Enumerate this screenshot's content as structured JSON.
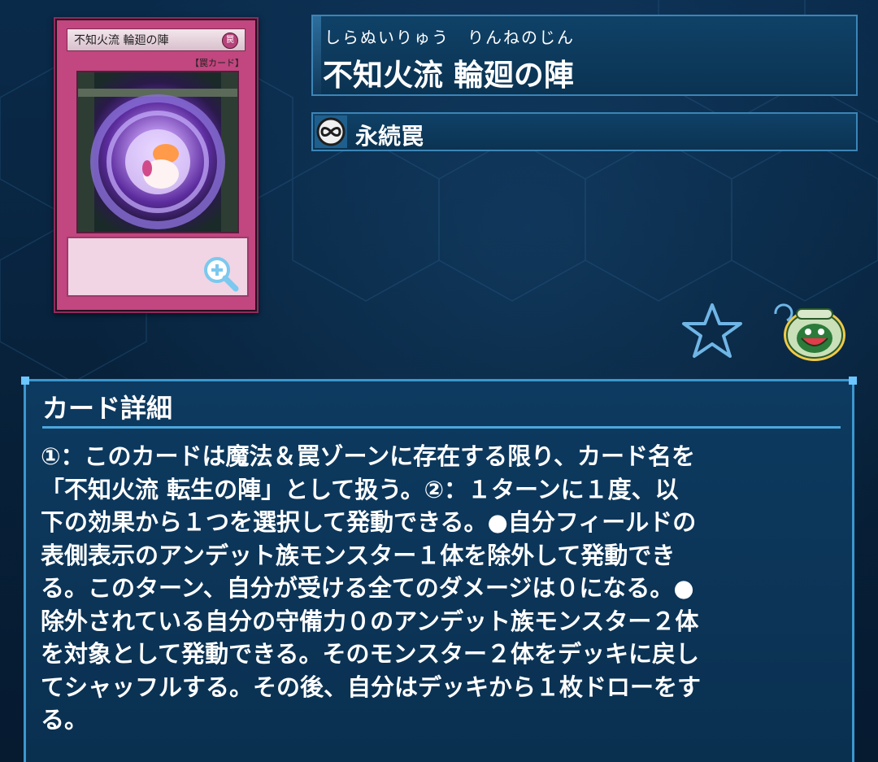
{
  "card": {
    "image_name_text": "不知火流 輪廻の陣",
    "image_type_text": "【罠カード】",
    "furigana": "しらぬいりゅう　りんねのじん",
    "name": "不知火流 輪廻の陣",
    "type_label": "永続罠",
    "type_icon": "continuous-icon"
  },
  "actions": {
    "zoom_icon": "zoom-in-icon",
    "favorite_icon": "star-icon",
    "pot_icon": "pot-of-greed-icon"
  },
  "details": {
    "title": "カード詳細",
    "text": "①：このカードは魔法＆罠ゾーンに存在する限り、カード名を\n「不知火流 転生の陣」として扱う。②：１ターンに１度、以\n下の効果から１つを選択して発動できる。●自分フィールドの\n表側表示のアンデット族モンスター１体を除外して発動でき\nる。このターン、自分が受ける全てのダメージは０になる。●\n除外されている自分の守備力０のアンデット族モンスター２体\nを対象として発動できる。そのモンスター２体をデッキに戻し\nてシャッフルする。その後、自分はデッキから１枚ドローをす\nる。"
  },
  "colors": {
    "background": "#07223f",
    "panel": "#0d3a60",
    "panel_border": "#3c97cf",
    "trap_card": "#c2467f"
  }
}
